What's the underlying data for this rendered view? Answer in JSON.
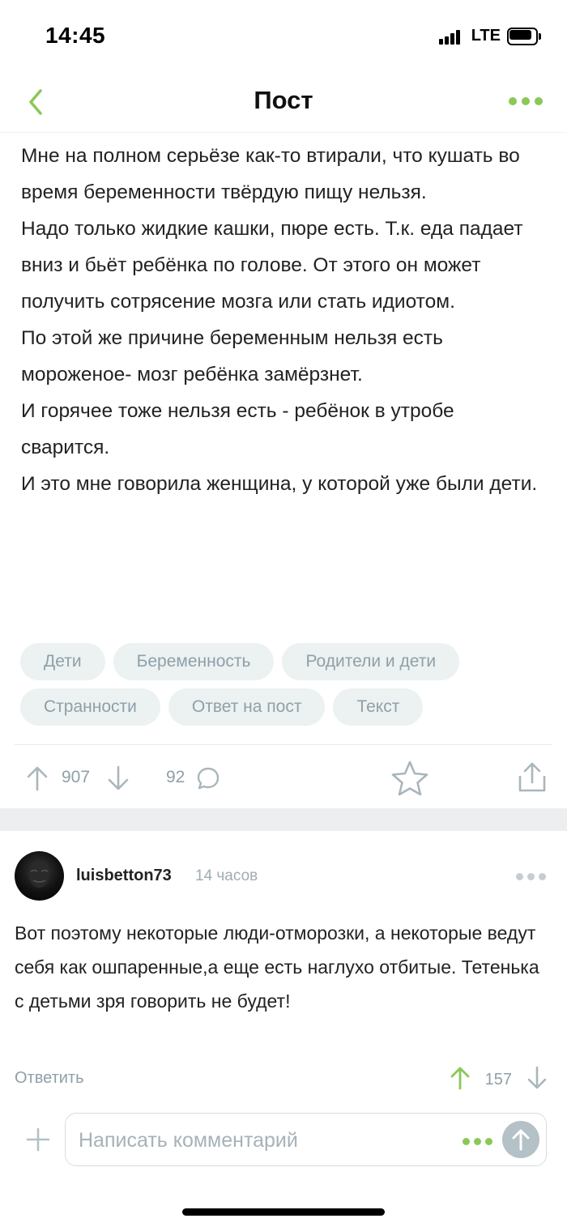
{
  "status_bar": {
    "time": "14:45",
    "network": "LTE",
    "icons": [
      "signal-icon",
      "battery-icon"
    ]
  },
  "nav": {
    "title": "Пост",
    "back_icon": "chevron-left-icon",
    "more_icon": "more-dots-icon",
    "accent_color": "#8ac858"
  },
  "post": {
    "paragraphs": [
      "Мне на полном серьёзе как-то втирали, что кушать во время беременности твёрдую пищу нельзя.",
      "Надо только жидкие кашки, пюре есть. Т.к. еда падает вниз и бьёт ребёнка по голове. От этого он может получить сотрясение  мозга или стать идиотом.",
      "По этой же причине беременным нельзя есть мороженое- мозг ребёнка замёрзнет.",
      "И горячее тоже нельзя есть - ребёнок в утробе сварится.",
      "И это мне говорила женщина, у которой уже были дети."
    ],
    "tags": [
      "Дети",
      "Беременность",
      "Родители и дети",
      "Странности",
      "Ответ на пост",
      "Текст"
    ],
    "rating": "907",
    "comments_count": "92",
    "icons": [
      "arrow-up-icon",
      "arrow-down-icon",
      "comment-bubble-icon",
      "star-icon",
      "share-icon"
    ]
  },
  "comment": {
    "author": "luisbetton73",
    "time": "14 часов",
    "text": "Вот поэтому некоторые люди-отморозки, а некоторые ведут себя как ошпаренные,а еще есть наглухо отбитые. Тетенька с детьми зря говорить не будет!",
    "reply_label": "Ответить",
    "rating": "157",
    "upvote_color": "#8ac858"
  },
  "composer": {
    "placeholder": "Написать комментарий",
    "icons": [
      "plus-icon",
      "more-dots-icon",
      "send-arrow-icon"
    ]
  }
}
